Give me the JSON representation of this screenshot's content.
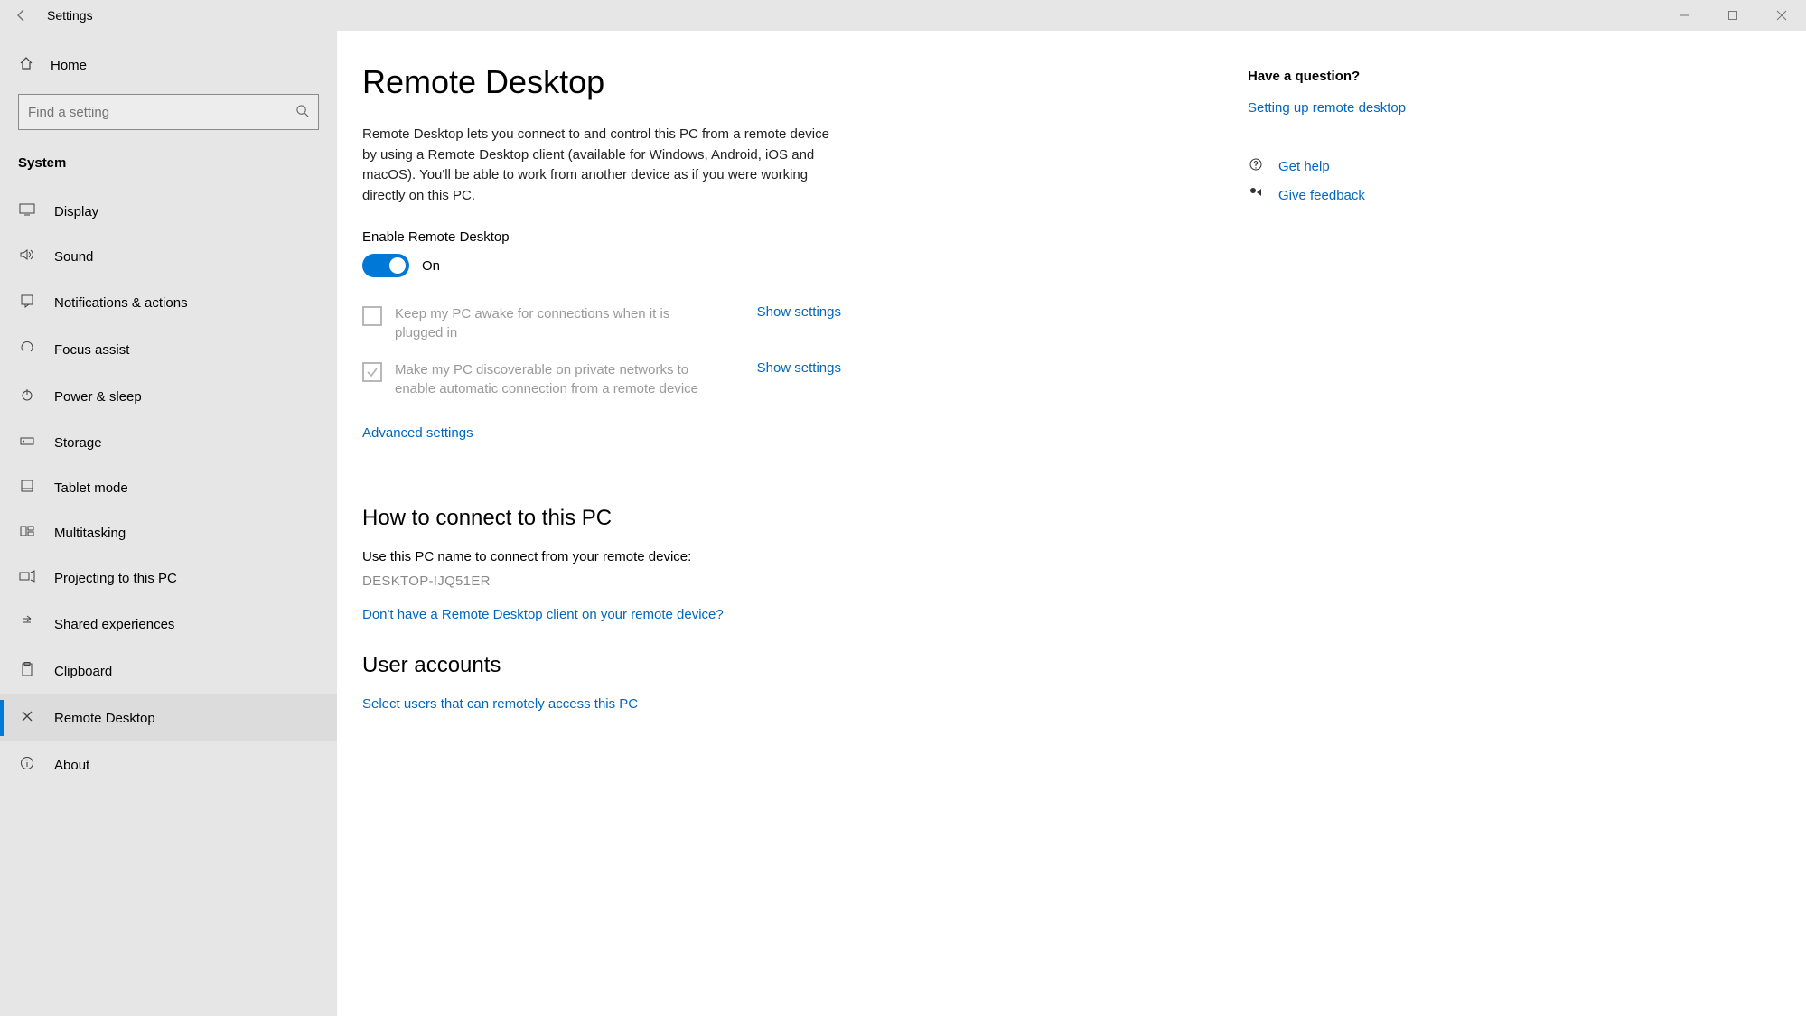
{
  "window": {
    "title": "Settings"
  },
  "sidebar": {
    "home": "Home",
    "search_placeholder": "Find a setting",
    "category": "System",
    "items": [
      {
        "label": "Display"
      },
      {
        "label": "Sound"
      },
      {
        "label": "Notifications & actions"
      },
      {
        "label": "Focus assist"
      },
      {
        "label": "Power & sleep"
      },
      {
        "label": "Storage"
      },
      {
        "label": "Tablet mode"
      },
      {
        "label": "Multitasking"
      },
      {
        "label": "Projecting to this PC"
      },
      {
        "label": "Shared experiences"
      },
      {
        "label": "Clipboard"
      },
      {
        "label": "Remote Desktop"
      },
      {
        "label": "About"
      }
    ]
  },
  "page": {
    "title": "Remote Desktop",
    "description": "Remote Desktop lets you connect to and control this PC from a remote device by using a Remote Desktop client (available for Windows, Android, iOS and macOS). You'll be able to work from another device as if you were working directly on this PC.",
    "enable_label": "Enable Remote Desktop",
    "toggle_state": "On",
    "checkbox1": "Keep my PC awake for connections when it is plugged in",
    "checkbox2": "Make my PC discoverable on private networks to enable automatic connection from a remote device",
    "show_settings": "Show settings",
    "advanced": "Advanced settings",
    "connect_heading": "How to connect to this PC",
    "connect_label": "Use this PC name to connect from your remote device:",
    "pc_name": "DESKTOP-IJQ51ER",
    "no_client_link": "Don't have a Remote Desktop client on your remote device?",
    "users_heading": "User accounts",
    "users_link": "Select users that can remotely access this PC"
  },
  "right": {
    "question": "Have a question?",
    "setup_link": "Setting up remote desktop",
    "get_help": "Get help",
    "give_feedback": "Give feedback"
  }
}
